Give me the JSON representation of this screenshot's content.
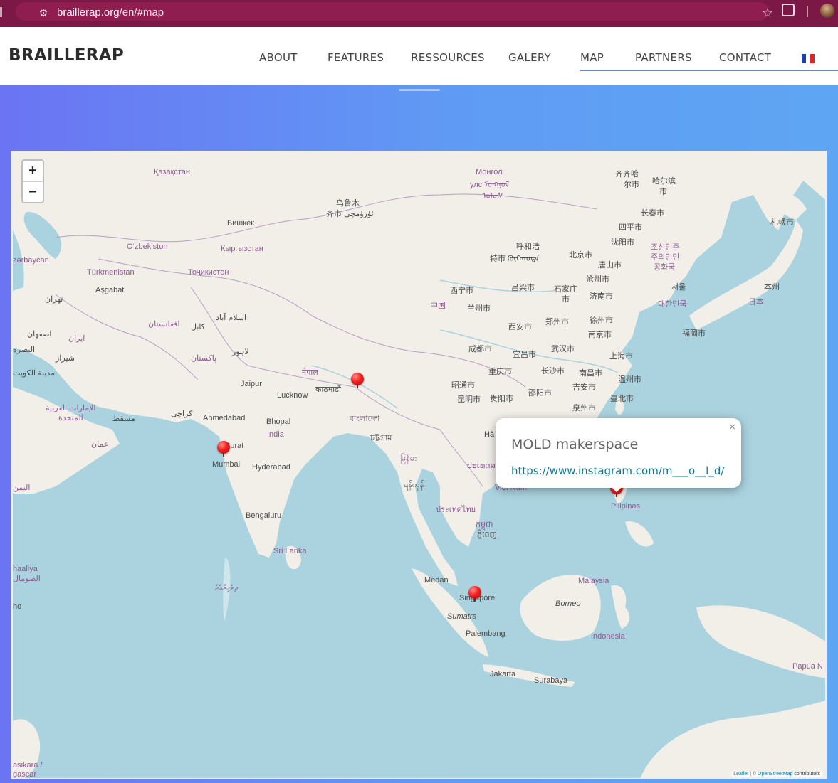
{
  "browser": {
    "url_host": "braillerap.org",
    "url_path": "/en/#map",
    "icons": [
      "tune-icon",
      "star-icon",
      "extensions-icon",
      "profile-avatar"
    ]
  },
  "header": {
    "brand": "BRAILLERAP",
    "nav": [
      "ABOUT",
      "FEATURES",
      "RESSOURCES",
      "GALERY",
      "MAP",
      "PARTNERS",
      "CONTACT"
    ],
    "active_nav": "MAP",
    "language_flag": "french-flag-icon"
  },
  "colors": {
    "browser_bar": "#7b1845",
    "gradient_start": "#6b74f3",
    "gradient_end": "#5ea6f3",
    "sea": "#aad3df",
    "land": "#f2efe9",
    "marker": "#f21f1f",
    "link": "#0a7b96"
  },
  "map": {
    "zoom_in": "+",
    "zoom_out": "−",
    "labels": {
      "kazakhstan": "Қазақстан",
      "mongolia": "Монгол",
      "mongolia2": "улс ᠮᠣᠩᠭᠣᠯ",
      "mongolia3": "ᠤᠯᠤᠰ",
      "qiqihar1": "齐齐哈",
      "qiqihar2": "尔市",
      "harbin1": "哈尔滨",
      "harbin2": "市",
      "urumqi1": "乌鲁木",
      "urumqi2": "齐市 ئۈرۈمچى",
      "bishkek": "Бишкек",
      "changchun": "长春市",
      "sapporo": "札幌市",
      "siping": "四平市",
      "uzbekistan": "O‘zbekiston",
      "kyrgyzstan": "Кыргызстан",
      "shenyang": "沈阳市",
      "nkorea1": "조선민주",
      "nkorea2": "주의인민",
      "nkorea3": "공화국",
      "azerbaijan": "zərbaycan",
      "hohhot1": "呼和浩",
      "hohhot2": "特市 ᠬᠥᠬᠡᠬᠣᠲᠠ",
      "beijing": "北京市",
      "tangshan": "唐山市",
      "turkmenistan": "Türkmenistan",
      "tajikistan": "Тоҷикистон",
      "ashgabat": "Aşgabat",
      "cangzhou": "沧州市",
      "seoul": "서울",
      "honshu": "本州",
      "xining": "西宁市",
      "lvliang": "吕梁市",
      "shijiazhuang1": "石家庄",
      "shijiazhuang2": "市",
      "jinan": "济南市",
      "tehran": "تهران",
      "china": "中国",
      "lanzhou": "兰州市",
      "skorea": "대한민국",
      "japan": "日本",
      "islamabad": "اسلام آباد",
      "afghanistan": "افغانستان",
      "kabul": "کابل",
      "xian": "西安市",
      "zhengzhou": "郑州市",
      "xuzhou": "徐州市",
      "isfahan": "اصفهان",
      "iran": "ایران",
      "nanjing": "南京市",
      "fukuoka": "福岡市",
      "basra": "البصرة",
      "lahore": "لاہور",
      "chengdu": "成都市",
      "wuhan": "武汉市",
      "yichang": "宜昌市",
      "shanghai": "上海市",
      "shiraz": "شیراز",
      "pakistan": "پاکستان",
      "kuwait": "مدينة الكويت",
      "nepal": "नेपाल",
      "chongqing": "重庆市",
      "changsha": "长沙市",
      "nanchang": "南昌市",
      "jaipur": "Jaipur",
      "kathmandu": "काठमाडौं",
      "zhaotong": "昭通市",
      "wenzhou": "温州市",
      "shaoyang": "邵阳市",
      "jian": "吉安市",
      "lucknow": "Lucknow",
      "uae1": "الإمارات العربية",
      "uae2": "المتحدة",
      "kunming": "昆明市",
      "guiyang": "贵阳市",
      "taipei": "臺北市",
      "quanzhou": "泉州市",
      "karachi": "کراچی",
      "muscat": "مسقط",
      "ahmedabad": "Ahmedabad",
      "bhopal": "Bhopal",
      "bangladesh": "বাংলাদেশ",
      "india": "India",
      "ctg": "চট্টগ্রাম",
      "oman": "عمان",
      "surat": "Surat",
      "myanmar": "မြန်မာ",
      "mumbai": "Mumbai",
      "hyderabad": "Hyderabad",
      "laos": "ປະເທດລາວ",
      "yemen": "اليمن",
      "yangon": "ရန်ကုန်",
      "vietnam": "Việt Nam",
      "pilipinas": "Pilipinas",
      "thailand": "ประเทศไทย",
      "bengaluru": "Bengaluru",
      "cambodia1": "កម្ពុជា",
      "cambodia2": "ភ្នំពេញ",
      "srilanka": "Sri Lanka",
      "somalia1": "haaliya",
      "somalia2": "الصومال",
      "maldives": "ދިވެހިރާއްޖެ",
      "medan": "Medan",
      "malaysia": "Malaysia",
      "singapore": "Singapore",
      "borneo": "Borneo",
      "sumatra": "Sumatra",
      "palembang": "Palembang",
      "indonesia": "Indonesia",
      "jakarta": "Jakarta",
      "surabaya": "Surabaya",
      "papua": "Papua N",
      "madagascar1": "asikara /",
      "madagascar2": "gascar",
      "ho": "ho",
      "ha": "Hà"
    },
    "markers": [
      {
        "name": "Kathmandu area marker"
      },
      {
        "name": "Surat marker"
      },
      {
        "name": "Singapore marker"
      },
      {
        "name": "Manila marker"
      }
    ],
    "popup": {
      "title": "MOLD makerspace",
      "link": "https://www.instagram.com/m___o__l_d/",
      "close": "×"
    },
    "attribution_leaflet": "Leaflet",
    "attribution_sep": " | © ",
    "attribution_osm": "OpenStreetMap",
    "attribution_tail": " contributors"
  }
}
